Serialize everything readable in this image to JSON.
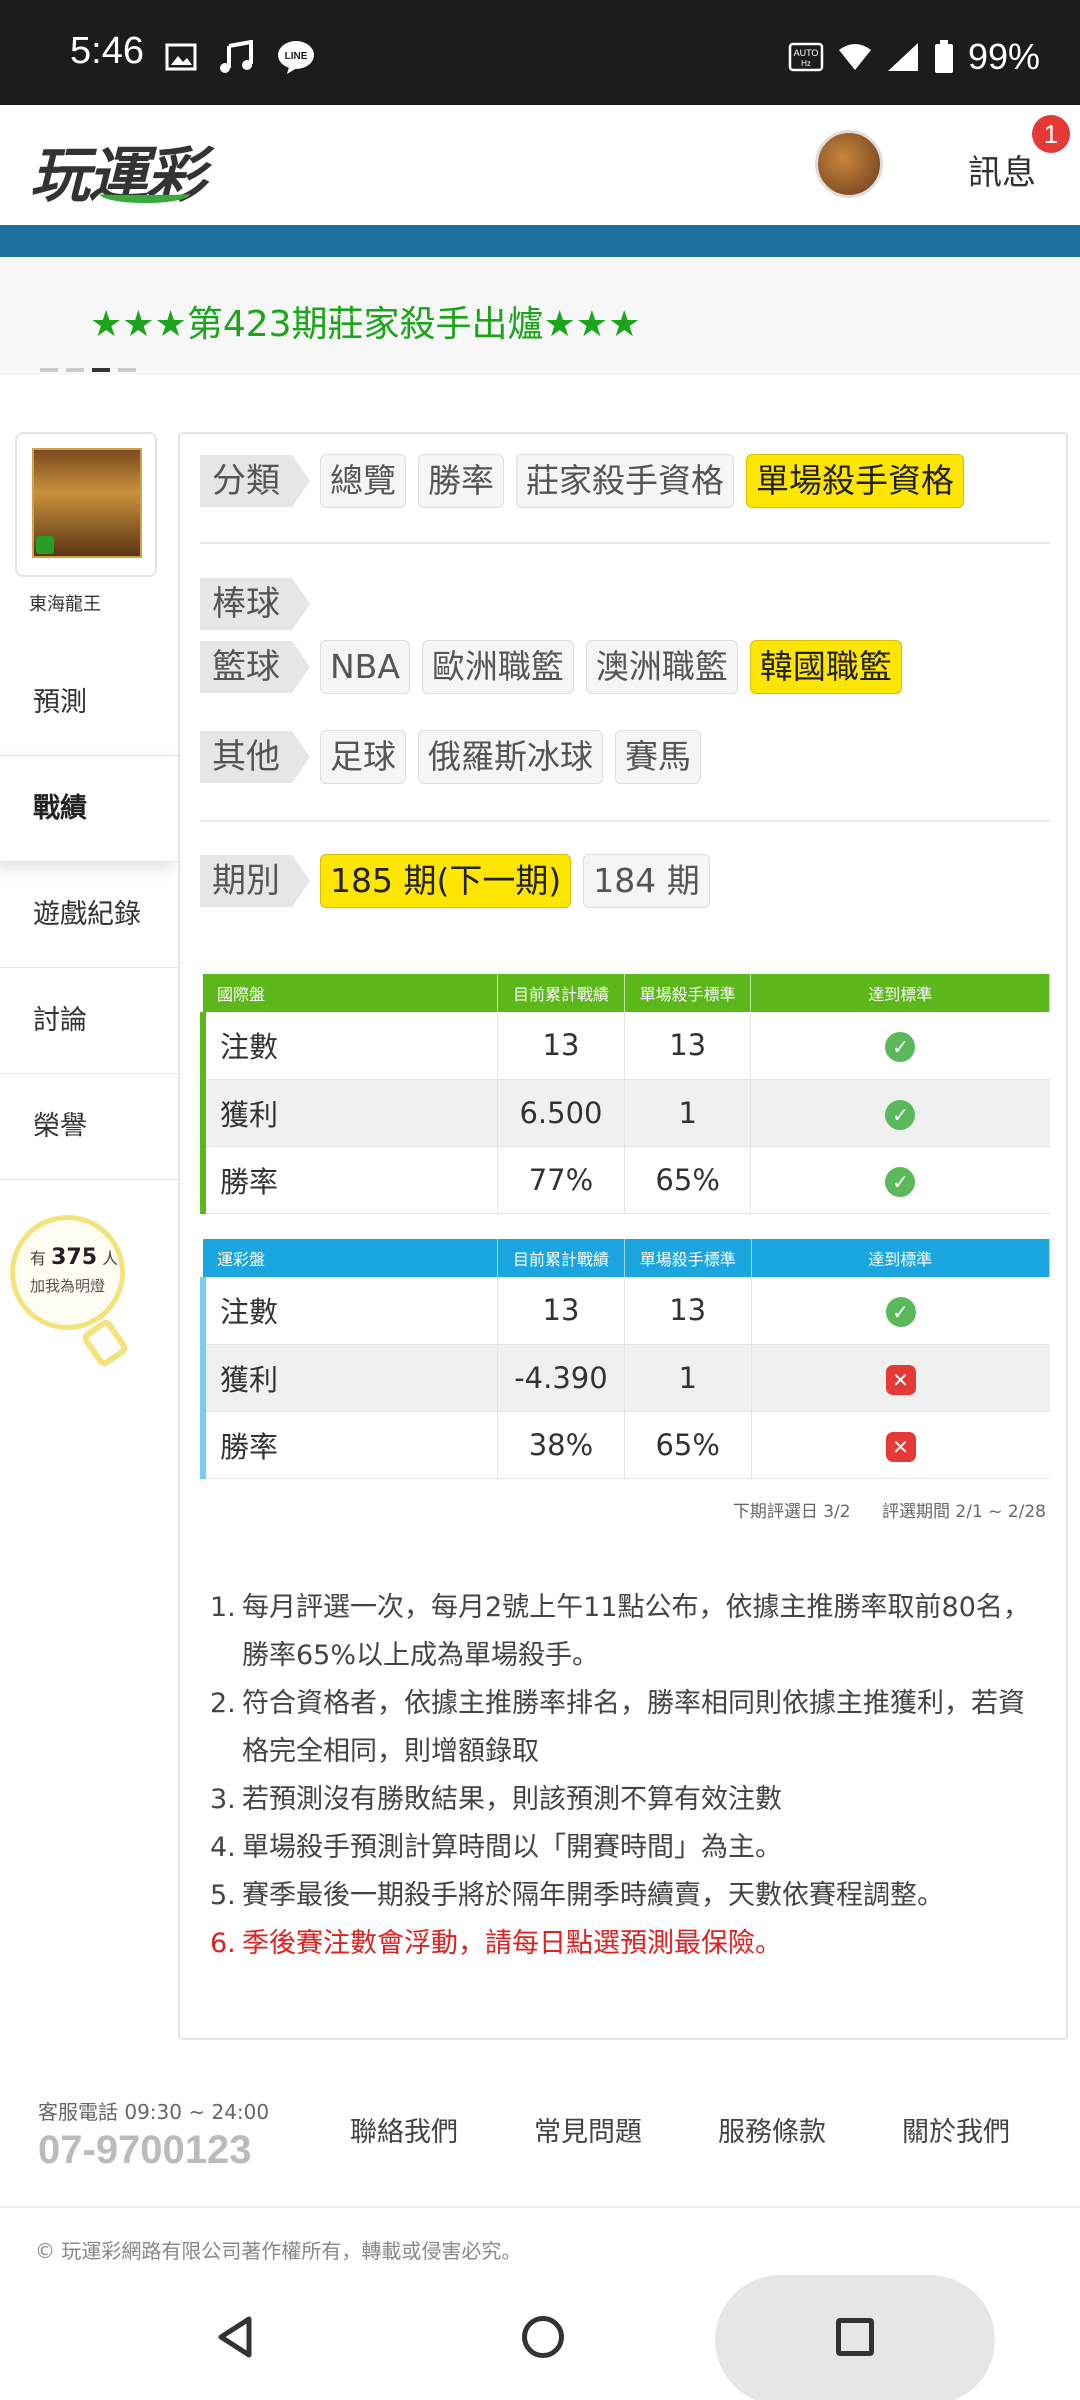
{
  "status_bar": {
    "time": "5:46",
    "battery": "99%",
    "icons": [
      "image-icon",
      "music-icon",
      "line-icon",
      "auto-hd-icon",
      "wifi-icon",
      "signal-icon",
      "battery-icon"
    ]
  },
  "header": {
    "logo_text": "玩運彩",
    "messages_label": "訊息",
    "badge_count": "1"
  },
  "marquee": {
    "text": "★★★第423期莊家殺手出爐★★★"
  },
  "sidebar": {
    "user_name": "東海龍王",
    "items": [
      {
        "label": "預測"
      },
      {
        "label": "戰績"
      },
      {
        "label": "遊戲紀錄"
      },
      {
        "label": "討論"
      },
      {
        "label": "榮譽"
      }
    ],
    "bulb": {
      "prefix": "有",
      "count": "375",
      "suffix": "人",
      "caption": "加我為明燈"
    }
  },
  "filters": {
    "category": {
      "label": "分類",
      "chips": [
        "總覽",
        "勝率",
        "莊家殺手資格",
        "單場殺手資格"
      ],
      "selected": "單場殺手資格"
    },
    "baseball": {
      "label": "棒球"
    },
    "basketball": {
      "label": "籃球",
      "chips": [
        "NBA",
        "歐洲職籃",
        "澳洲職籃",
        "韓國職籃"
      ],
      "selected": "韓國職籃"
    },
    "other": {
      "label": "其他",
      "chips": [
        "足球",
        "俄羅斯冰球",
        "賽馬"
      ]
    },
    "period": {
      "label": "期別",
      "chips": [
        "185 期(下一期)",
        "184 期"
      ],
      "selected": "185 期(下一期)"
    }
  },
  "table_international": {
    "headers": [
      "國際盤",
      "目前累計戰績",
      "單場殺手標準",
      "達到標準"
    ],
    "rows": [
      {
        "name": "注數",
        "current": "13",
        "standard": "13",
        "met": true
      },
      {
        "name": "獲利",
        "current": "6.500",
        "standard": "1",
        "met": true
      },
      {
        "name": "勝率",
        "current": "77%",
        "standard": "65%",
        "met": true
      }
    ]
  },
  "table_sportlottery": {
    "headers": [
      "運彩盤",
      "目前累計戰績",
      "單場殺手標準",
      "達到標準"
    ],
    "rows": [
      {
        "name": "注數",
        "current": "13",
        "standard": "13",
        "met": true
      },
      {
        "name": "獲利",
        "current": "-4.390",
        "standard": "1",
        "met": false
      },
      {
        "name": "勝率",
        "current": "38%",
        "standard": "65%",
        "met": false
      }
    ]
  },
  "eval_info": {
    "next_date": "下期評選日 3/2",
    "period": "評選期間 2/1 ~ 2/28"
  },
  "rules": [
    {
      "num": "1.",
      "text": "每月評選一次，每月2號上午11點公布，依據主推勝率取前80名，勝率65%以上成為單場殺手。"
    },
    {
      "num": "2.",
      "text": "符合資格者，依據主推勝率排名，勝率相同則依據主推獲利，若資格完全相同，則增額錄取"
    },
    {
      "num": "3.",
      "text": "若預測沒有勝敗結果，則該預測不算有效注數"
    },
    {
      "num": "4.",
      "text": "單場殺手預測計算時間以「開賽時間」為主。"
    },
    {
      "num": "5.",
      "text": "賽季最後一期殺手將於隔年開季時續賣，天數依賽程調整。"
    },
    {
      "num": "6.",
      "text": "季後賽注數會浮動，請每日點選預測最保險。",
      "highlight": true
    }
  ],
  "footer": {
    "service_hours": "客服電話 09:30 ~ 24:00",
    "phone": "07-9700123",
    "links": [
      "聯絡我們",
      "常見問題",
      "服務條款",
      "關於我們"
    ],
    "copyright": "© 玩運彩網路有限公司著作權所有，轉載或侵害必究。"
  },
  "colors": {
    "green_header": "#5cb81a",
    "blue_header": "#1ca6e0",
    "selected_chip": "#ffe600",
    "brand_blue_bar": "#1f6fa1",
    "marquee_green": "#1aa51a"
  }
}
